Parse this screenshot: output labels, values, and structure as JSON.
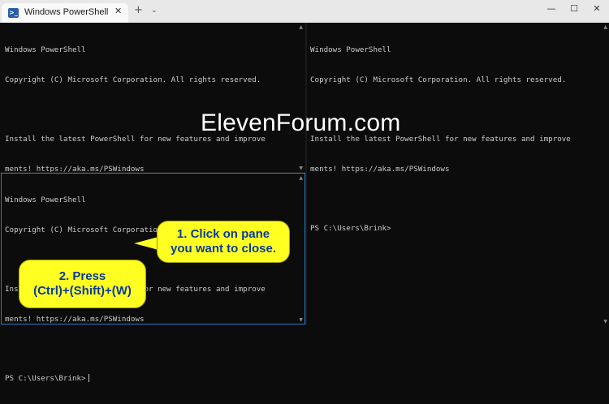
{
  "titlebar": {
    "tab_title": "Windows PowerShell",
    "tab_close": "✕",
    "new_tab": "+",
    "dropdown": "⌄",
    "minimize": "—",
    "maximize": "☐",
    "close": "✕"
  },
  "terminal": {
    "lines": [
      "Windows PowerShell",
      "Copyright (C) Microsoft Corporation. All rights reserved.",
      "",
      "Install the latest PowerShell for new features and improve",
      "ments! https://aka.ms/PSWindows",
      "",
      "PS C:\\Users\\Brink>"
    ]
  },
  "watermark": "ElevenForum.com",
  "callouts": {
    "one": [
      "1. Click on pane",
      "you want to close."
    ],
    "two": [
      "2. Press",
      "(Ctrl)+(Shift)+(W)"
    ]
  },
  "scroll": {
    "up": "▲",
    "down": "▼"
  },
  "colors": {
    "terminal_bg": "#0c0c0c",
    "terminal_text": "#cccccc",
    "focus_border": "#2f78c6",
    "callout_bg": "#ffff22",
    "callout_text": "#0a3a9a"
  }
}
